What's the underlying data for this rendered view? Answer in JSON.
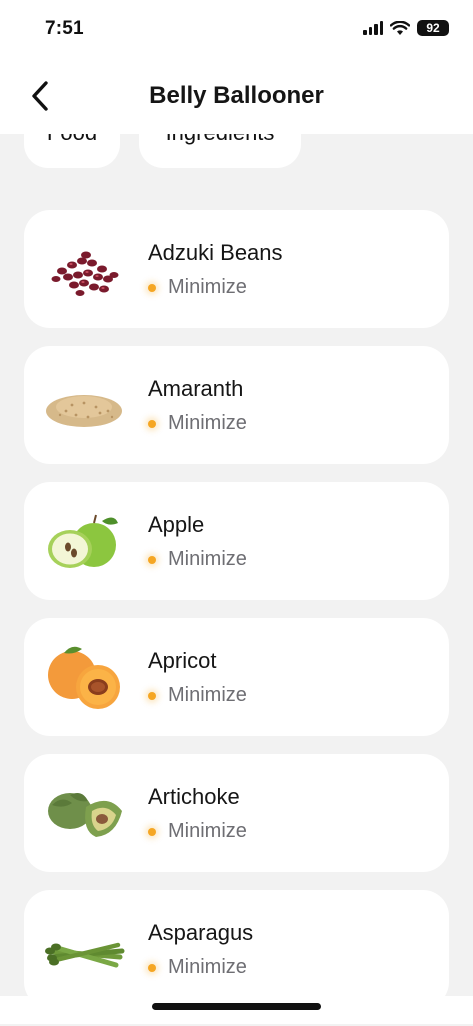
{
  "status_bar": {
    "time": "7:51",
    "battery": "92"
  },
  "nav": {
    "title": "Belly Ballooner"
  },
  "filters": [
    {
      "label": "Food"
    },
    {
      "label": "Ingredients"
    }
  ],
  "items": [
    {
      "name": "Adzuki Beans",
      "status": "Minimize",
      "icon": "adzuki-beans-image"
    },
    {
      "name": "Amaranth",
      "status": "Minimize",
      "icon": "amaranth-image"
    },
    {
      "name": "Apple",
      "status": "Minimize",
      "icon": "apple-image"
    },
    {
      "name": "Apricot",
      "status": "Minimize",
      "icon": "apricot-image"
    },
    {
      "name": "Artichoke",
      "status": "Minimize",
      "icon": "artichoke-image"
    },
    {
      "name": "Asparagus",
      "status": "Minimize",
      "icon": "asparagus-image"
    }
  ],
  "colors": {
    "status_dot": "#f5a623",
    "background": "#f2f2f2",
    "card": "#ffffff"
  }
}
